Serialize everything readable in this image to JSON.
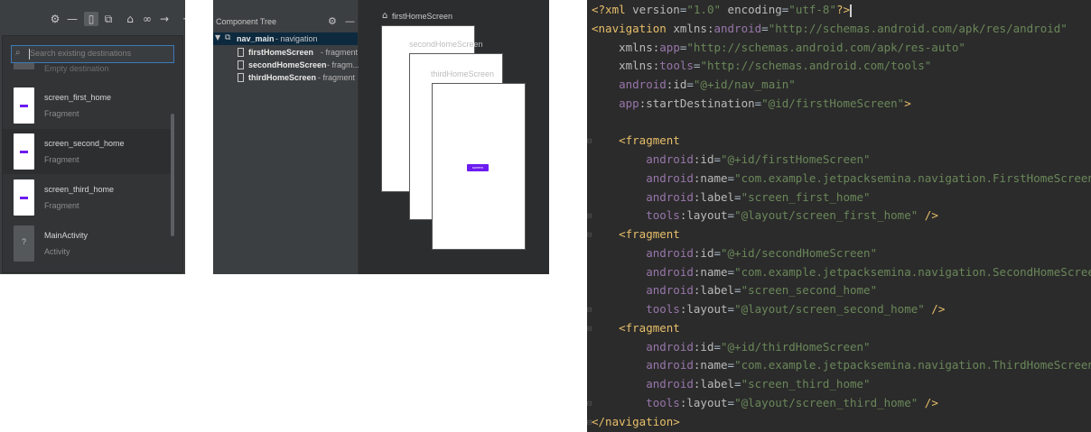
{
  "panel1": {
    "search_placeholder": "Search existing destinations",
    "ghost_label": "Empty destination",
    "destinations": [
      {
        "name": "screen_first_home",
        "type": "Fragment"
      },
      {
        "name": "screen_second_home",
        "type": "Fragment"
      },
      {
        "name": "screen_third_home",
        "type": "Fragment"
      },
      {
        "name": "MainActivity",
        "type": "Activity",
        "thumb_glyph": "?"
      }
    ],
    "toolbar_icons": [
      "gear-icon",
      "minimize-icon",
      "new-destination-icon",
      "nested-graph-icon",
      "home-icon",
      "link-icon",
      "arrow-right-icon",
      "more-icon"
    ]
  },
  "panel2": {
    "tree_title": "Component Tree",
    "root": {
      "name": "nav_main",
      "suffix": "- navigation"
    },
    "nodes": [
      {
        "name": "firstHomeScreen",
        "suffix": "- fragment"
      },
      {
        "name": "secondHomeScreen",
        "suffix": "- fragm..."
      },
      {
        "name": "thirdHomeScreen",
        "suffix": "- fragment"
      }
    ],
    "design": {
      "labels": [
        "firstHomeScreen",
        "secondHomeScreen",
        "thirdHomeScreen"
      ],
      "button_text": "screen"
    }
  },
  "code": {
    "lines": [
      {
        "tokens": [
          {
            "t": "<?xml ",
            "c": "t-tag"
          },
          {
            "t": "version",
            "c": "t-attr"
          },
          {
            "t": "=",
            "c": "t-plain"
          },
          {
            "t": "\"1.0\"",
            "c": "t-val"
          },
          {
            "t": " ",
            "c": "t-plain"
          },
          {
            "t": "encoding",
            "c": "t-attr"
          },
          {
            "t": "=",
            "c": "t-plain"
          },
          {
            "t": "\"utf-8\"",
            "c": "t-val"
          },
          {
            "t": "?>",
            "c": "t-tag"
          }
        ],
        "caret": true
      },
      {
        "tokens": [
          {
            "t": "<navigation ",
            "c": "t-tag"
          },
          {
            "t": "xmlns:",
            "c": "t-attr"
          },
          {
            "t": "android",
            "c": "t-ns"
          },
          {
            "t": "=",
            "c": "t-plain"
          },
          {
            "t": "\"http://schemas.android.com/apk/res/android\"",
            "c": "t-val"
          }
        ]
      },
      {
        "tokens": [
          {
            "t": "    xmlns:",
            "c": "t-attr"
          },
          {
            "t": "app",
            "c": "t-ns"
          },
          {
            "t": "=",
            "c": "t-plain"
          },
          {
            "t": "\"http://schemas.android.com/apk/res-auto\"",
            "c": "t-val"
          }
        ]
      },
      {
        "tokens": [
          {
            "t": "    xmlns:",
            "c": "t-attr"
          },
          {
            "t": "tools",
            "c": "t-ns"
          },
          {
            "t": "=",
            "c": "t-plain"
          },
          {
            "t": "\"http://schemas.android.com/tools\"",
            "c": "t-val"
          }
        ]
      },
      {
        "tokens": [
          {
            "t": "    android",
            "c": "t-ns"
          },
          {
            "t": ":id",
            "c": "t-attr"
          },
          {
            "t": "=",
            "c": "t-plain"
          },
          {
            "t": "\"@+id/nav_main\"",
            "c": "t-val"
          }
        ]
      },
      {
        "tokens": [
          {
            "t": "    app",
            "c": "t-ns"
          },
          {
            "t": ":startDestination",
            "c": "t-attr"
          },
          {
            "t": "=",
            "c": "t-plain"
          },
          {
            "t": "\"@id/firstHomeScreen\"",
            "c": "t-val"
          },
          {
            "t": ">",
            "c": "t-tag"
          }
        ]
      },
      {
        "tokens": [
          {
            "t": " ",
            "c": "t-plain"
          }
        ]
      },
      {
        "tokens": [
          {
            "t": "    <fragment",
            "c": "t-tag"
          }
        ],
        "fold": true
      },
      {
        "tokens": [
          {
            "t": "        android",
            "c": "t-ns"
          },
          {
            "t": ":id",
            "c": "t-attr"
          },
          {
            "t": "=",
            "c": "t-plain"
          },
          {
            "t": "\"@+id/firstHomeScreen\"",
            "c": "t-val"
          }
        ]
      },
      {
        "tokens": [
          {
            "t": "        android",
            "c": "t-ns"
          },
          {
            "t": ":name",
            "c": "t-attr"
          },
          {
            "t": "=",
            "c": "t-plain"
          },
          {
            "t": "\"com.example.jetpacksemina.navigation.FirstHomeScreen\"",
            "c": "t-val"
          }
        ]
      },
      {
        "tokens": [
          {
            "t": "        android",
            "c": "t-ns"
          },
          {
            "t": ":label",
            "c": "t-attr"
          },
          {
            "t": "=",
            "c": "t-plain"
          },
          {
            "t": "\"screen_first_home\"",
            "c": "t-val"
          }
        ]
      },
      {
        "tokens": [
          {
            "t": "        tools",
            "c": "t-ns"
          },
          {
            "t": ":layout",
            "c": "t-attr"
          },
          {
            "t": "=",
            "c": "t-plain"
          },
          {
            "t": "\"@layout/screen_first_home\"",
            "c": "t-val"
          },
          {
            "t": " />",
            "c": "t-tag"
          }
        ],
        "fold": true
      },
      {
        "tokens": [
          {
            "t": "    <fragment",
            "c": "t-tag"
          }
        ],
        "fold": true
      },
      {
        "tokens": [
          {
            "t": "        android",
            "c": "t-ns"
          },
          {
            "t": ":id",
            "c": "t-attr"
          },
          {
            "t": "=",
            "c": "t-plain"
          },
          {
            "t": "\"@+id/secondHomeScreen\"",
            "c": "t-val"
          }
        ]
      },
      {
        "tokens": [
          {
            "t": "        android",
            "c": "t-ns"
          },
          {
            "t": ":name",
            "c": "t-attr"
          },
          {
            "t": "=",
            "c": "t-plain"
          },
          {
            "t": "\"com.example.jetpacksemina.navigation.SecondHomeScreen\"",
            "c": "t-val"
          }
        ]
      },
      {
        "tokens": [
          {
            "t": "        android",
            "c": "t-ns"
          },
          {
            "t": ":label",
            "c": "t-attr"
          },
          {
            "t": "=",
            "c": "t-plain"
          },
          {
            "t": "\"screen_second_home\"",
            "c": "t-val"
          }
        ]
      },
      {
        "tokens": [
          {
            "t": "        tools",
            "c": "t-ns"
          },
          {
            "t": ":layout",
            "c": "t-attr"
          },
          {
            "t": "=",
            "c": "t-plain"
          },
          {
            "t": "\"@layout/screen_second_home\"",
            "c": "t-val"
          },
          {
            "t": " />",
            "c": "t-tag"
          }
        ],
        "fold": true
      },
      {
        "tokens": [
          {
            "t": "    <fragment",
            "c": "t-tag"
          }
        ],
        "fold": true
      },
      {
        "tokens": [
          {
            "t": "        android",
            "c": "t-ns"
          },
          {
            "t": ":id",
            "c": "t-attr"
          },
          {
            "t": "=",
            "c": "t-plain"
          },
          {
            "t": "\"@+id/thirdHomeScreen\"",
            "c": "t-val"
          }
        ]
      },
      {
        "tokens": [
          {
            "t": "        android",
            "c": "t-ns"
          },
          {
            "t": ":name",
            "c": "t-attr"
          },
          {
            "t": "=",
            "c": "t-plain"
          },
          {
            "t": "\"com.example.jetpacksemina.navigation.ThirdHomeScreen\"",
            "c": "t-val"
          }
        ]
      },
      {
        "tokens": [
          {
            "t": "        android",
            "c": "t-ns"
          },
          {
            "t": ":label",
            "c": "t-attr"
          },
          {
            "t": "=",
            "c": "t-plain"
          },
          {
            "t": "\"screen_third_home\"",
            "c": "t-val"
          }
        ]
      },
      {
        "tokens": [
          {
            "t": "        tools",
            "c": "t-ns"
          },
          {
            "t": ":layout",
            "c": "t-attr"
          },
          {
            "t": "=",
            "c": "t-plain"
          },
          {
            "t": "\"@layout/screen_third_home\"",
            "c": "t-val"
          },
          {
            "t": " />",
            "c": "t-tag"
          }
        ],
        "fold": true
      },
      {
        "tokens": [
          {
            "t": "</navigation>",
            "c": "t-tag"
          }
        ],
        "fold": true
      }
    ]
  },
  "colors": {
    "ide_bg": "#3c3f41",
    "editor_bg": "#2b2b2b",
    "accent_purple": "#6c1cf0",
    "selection_blue": "#0d293e"
  }
}
